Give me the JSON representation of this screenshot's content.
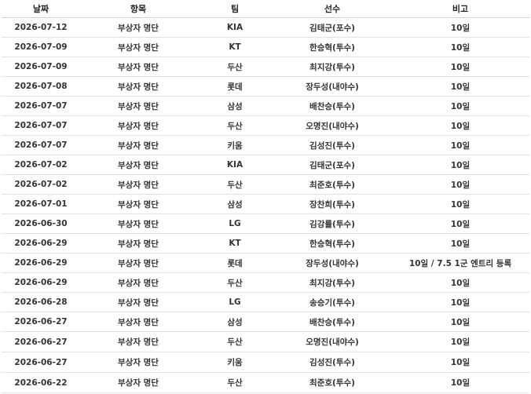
{
  "table": {
    "headers": [
      "날짜",
      "항목",
      "팀",
      "선수",
      "비고"
    ],
    "rows": [
      {
        "date": "2026-07-12",
        "item": "부상자 명단",
        "team": "KIA",
        "player": "김태군(포수)",
        "note": "10일"
      },
      {
        "date": "2026-07-09",
        "item": "부상자 명단",
        "team": "KT",
        "player": "한승혁(투수)",
        "note": "10일"
      },
      {
        "date": "2026-07-09",
        "item": "부상자 명단",
        "team": "두산",
        "player": "최지강(투수)",
        "note": "10일"
      },
      {
        "date": "2026-07-08",
        "item": "부상자 명단",
        "team": "롯데",
        "player": "장두성(내야수)",
        "note": "10일"
      },
      {
        "date": "2026-07-07",
        "item": "부상자 명단",
        "team": "삼성",
        "player": "배찬승(투수)",
        "note": "10일"
      },
      {
        "date": "2026-07-07",
        "item": "부상자 명단",
        "team": "두산",
        "player": "오명진(내야수)",
        "note": "10일"
      },
      {
        "date": "2026-07-07",
        "item": "부상자 명단",
        "team": "키움",
        "player": "김성진(투수)",
        "note": "10일"
      },
      {
        "date": "2026-07-02",
        "item": "부상자 명단",
        "team": "KIA",
        "player": "김태군(포수)",
        "note": "10일"
      },
      {
        "date": "2026-07-02",
        "item": "부상자 명단",
        "team": "두산",
        "player": "최준호(투수)",
        "note": "10일"
      },
      {
        "date": "2026-07-01",
        "item": "부상자 명단",
        "team": "삼성",
        "player": "장찬희(투수)",
        "note": "10일"
      },
      {
        "date": "2026-06-30",
        "item": "부상자 명단",
        "team": "LG",
        "player": "김강률(투수)",
        "note": "10일"
      },
      {
        "date": "2026-06-29",
        "item": "부상자 명단",
        "team": "KT",
        "player": "한승혁(투수)",
        "note": "10일"
      },
      {
        "date": "2026-06-29",
        "item": "부상자 명단",
        "team": "롯데",
        "player": "장두성(내야수)",
        "note": "10일 / 7.5 1군 엔트리 등록"
      },
      {
        "date": "2026-06-29",
        "item": "부상자 명단",
        "team": "두산",
        "player": "최지강(투수)",
        "note": "10일"
      },
      {
        "date": "2026-06-28",
        "item": "부상자 명단",
        "team": "LG",
        "player": "송승기(투수)",
        "note": "10일"
      },
      {
        "date": "2026-06-27",
        "item": "부상자 명단",
        "team": "삼성",
        "player": "배찬승(투수)",
        "note": "10일"
      },
      {
        "date": "2026-06-27",
        "item": "부상자 명단",
        "team": "두산",
        "player": "오명진(내야수)",
        "note": "10일"
      },
      {
        "date": "2026-06-27",
        "item": "부상자 명단",
        "team": "키움",
        "player": "김성진(투수)",
        "note": "10일"
      },
      {
        "date": "2026-06-22",
        "item": "부상자 명단",
        "team": "두산",
        "player": "최준호(투수)",
        "note": "10일"
      }
    ]
  }
}
